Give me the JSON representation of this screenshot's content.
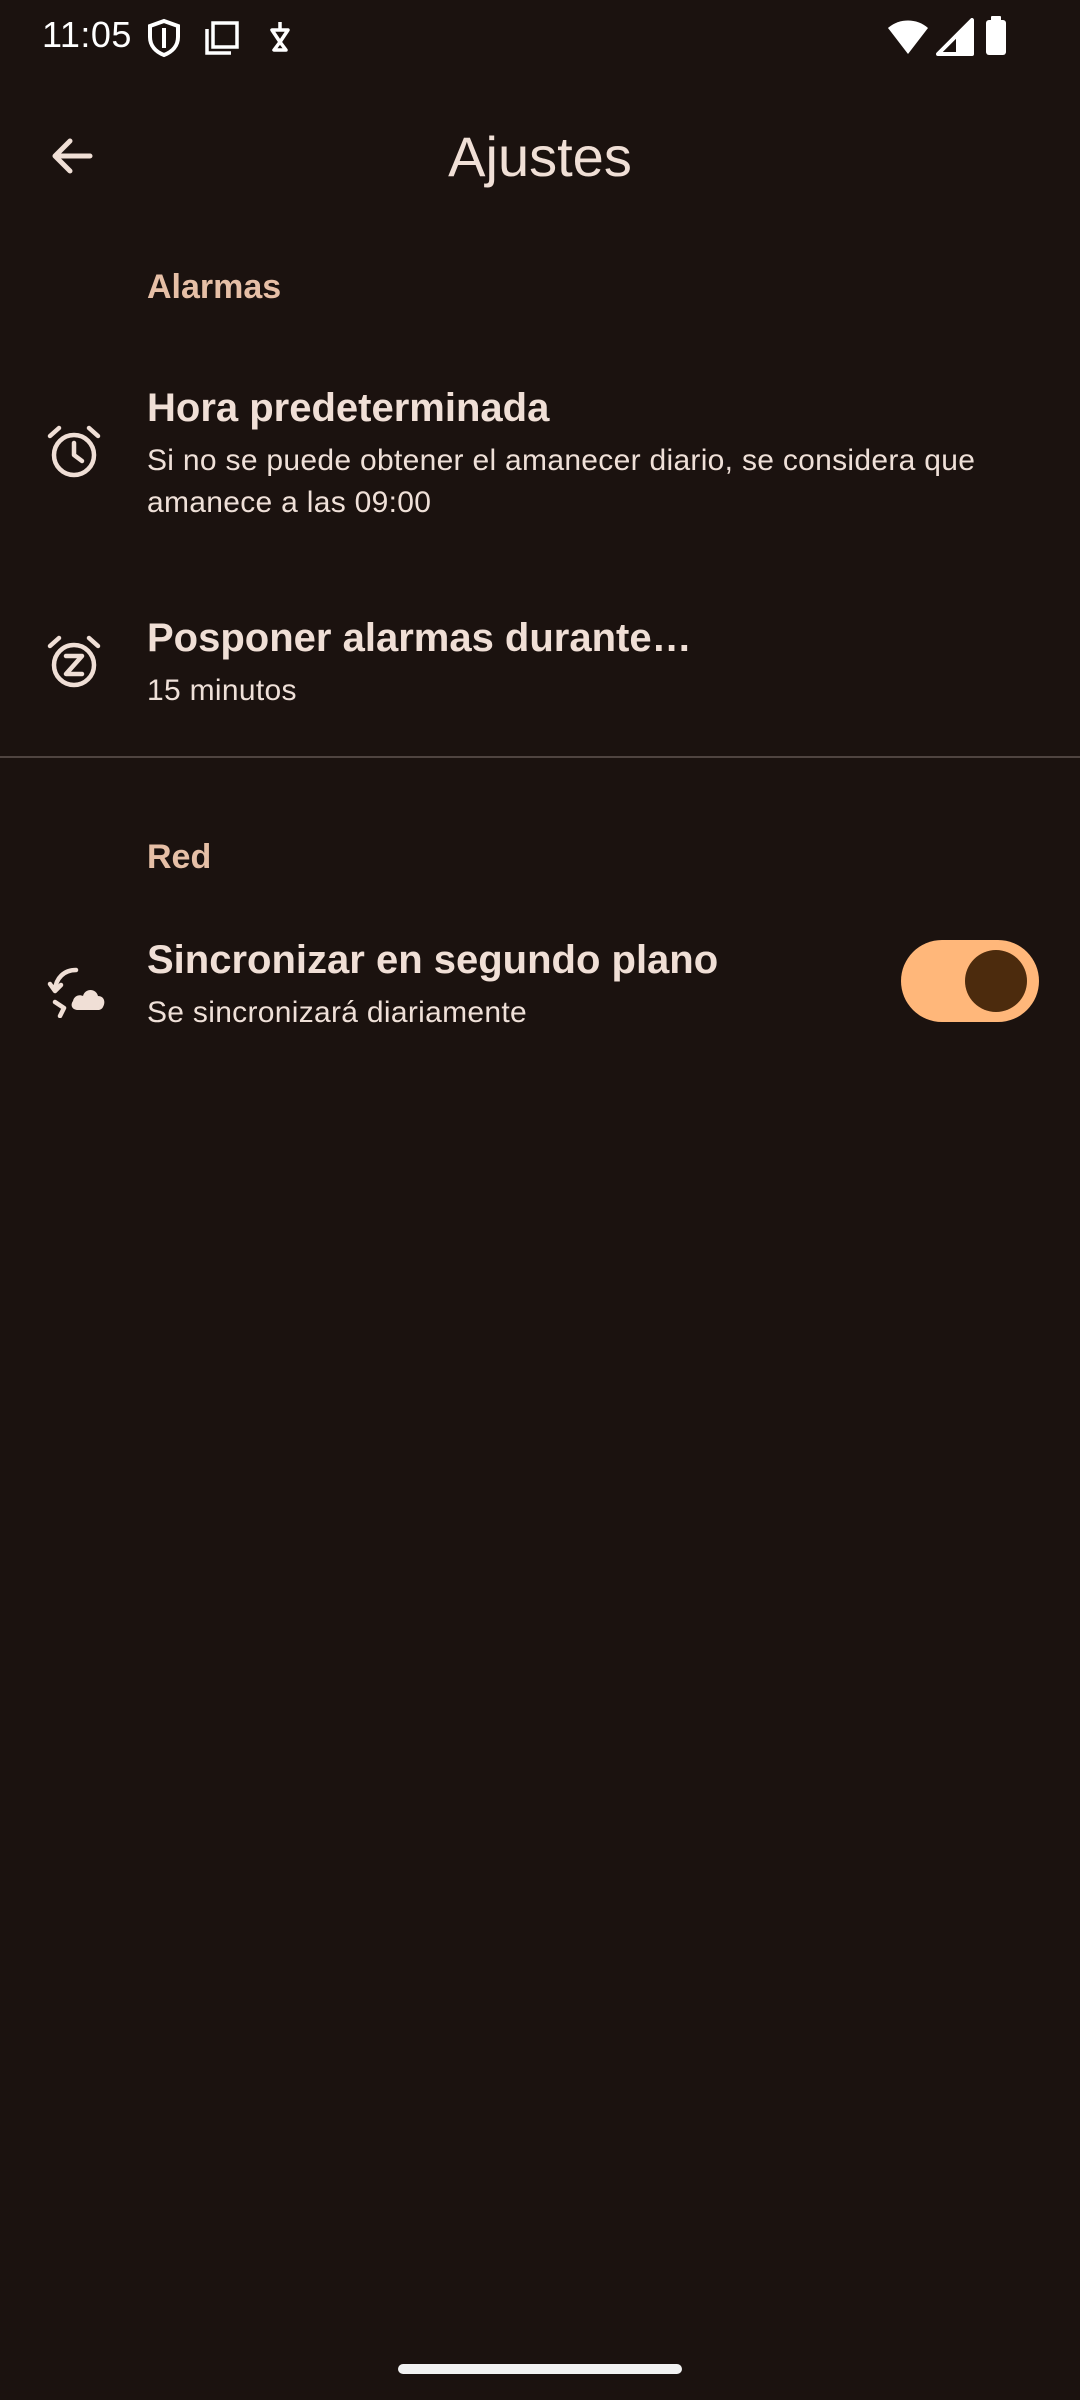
{
  "status_bar": {
    "time": "11:05",
    "icons": [
      "shield-icon",
      "screenshot-icon",
      "usb-debug-icon",
      "wifi-icon",
      "signal-icon",
      "battery-icon"
    ]
  },
  "app_bar": {
    "title": "Ajustes",
    "back_icon": "arrow-back-icon"
  },
  "sections": {
    "alarms": {
      "header": "Alarmas",
      "items": [
        {
          "icon": "alarm-clock-icon",
          "title": "Hora predeterminada",
          "summary": "Si no se puede obtener el amanecer diario, se considera que amanece a las 09:00"
        },
        {
          "icon": "snooze-icon",
          "title": "Posponer alarmas durante…",
          "summary": "15 minutos"
        }
      ]
    },
    "network": {
      "header": "Red",
      "items": [
        {
          "icon": "cloud-sync-icon",
          "title": "Sincronizar en segundo plano",
          "summary": "Se sincronizará diariamente",
          "switch_on": true
        }
      ]
    }
  },
  "colors": {
    "background": "#1b120f",
    "accent": "#ffb77a",
    "section_header": "#e6bfa6",
    "text": "#f0dfd6"
  }
}
